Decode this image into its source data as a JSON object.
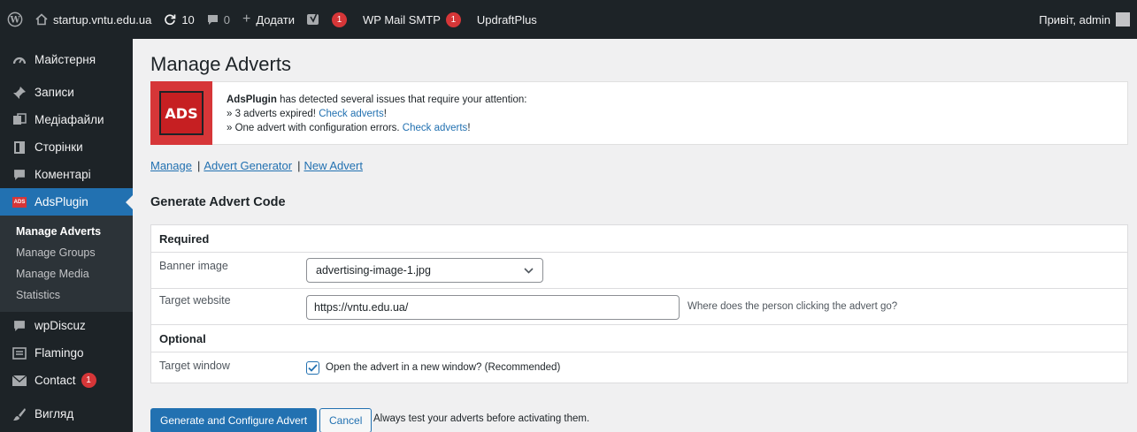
{
  "adminbar": {
    "site_name": "startup.vntu.edu.ua",
    "updates_count": "10",
    "comments_count": "0",
    "new_label": "Додати",
    "yoast_count": "1",
    "wpmail_label": "WP Mail SMTP",
    "wpmail_count": "1",
    "updraft_label": "UpdraftPlus",
    "greeting": "Привіт, admin"
  },
  "sidebar": {
    "items": [
      {
        "label": "Майстерня",
        "icon": "dashboard-icon"
      },
      {
        "label": "Записи",
        "icon": "pin-icon"
      },
      {
        "label": "Медіафайли",
        "icon": "media-icon"
      },
      {
        "label": "Сторінки",
        "icon": "page-icon"
      },
      {
        "label": "Коментарі",
        "icon": "comment-icon"
      },
      {
        "label": "AdsPlugin",
        "icon": "ads-icon"
      }
    ],
    "submenu": [
      {
        "label": "Manage Adverts"
      },
      {
        "label": "Manage Groups"
      },
      {
        "label": "Manage Media"
      },
      {
        "label": "Statistics"
      }
    ],
    "bottom_items": [
      {
        "label": "wpDiscuz",
        "icon": "comment-icon"
      },
      {
        "label": "Flamingo",
        "icon": "inbox-icon"
      },
      {
        "label": "Contact",
        "icon": "mail-icon",
        "count": "1"
      },
      {
        "label": "Вигляд",
        "icon": "brush-icon"
      }
    ]
  },
  "page": {
    "title": "Manage Adverts",
    "notice": {
      "logo_text": "ADS",
      "plugin_name": "AdsPlugin",
      "message": " has detected several issues that require your attention:",
      "line1_prefix": "» 3 adverts expired! ",
      "line2_prefix": "» One advert with configuration errors. ",
      "link_label": "Check adverts",
      "link_suffix": "!"
    },
    "nav": {
      "manage": "Manage",
      "generator": "Advert Generator",
      "new_advert": "New Advert",
      "separator": "|"
    },
    "section_title": "Generate Advert Code",
    "form": {
      "required_heading": "Required",
      "banner_label": "Banner image",
      "banner_value": "advertising-image-1.jpg",
      "target_label": "Target website",
      "target_value": "https://vntu.edu.ua/",
      "target_hint": "Where does the person clicking the advert go?",
      "optional_heading": "Optional",
      "window_label": "Target window",
      "window_checkbox_label": "Open the advert in a new window? (Recommended)",
      "window_checked": true
    },
    "buttons": {
      "generate": "Generate and Configure Advert",
      "cancel": "Cancel",
      "note": "Always test your adverts before activating them."
    }
  },
  "colors": {
    "accent": "#2271b1",
    "admin_bg": "#1d2327",
    "alert": "#d63638"
  }
}
